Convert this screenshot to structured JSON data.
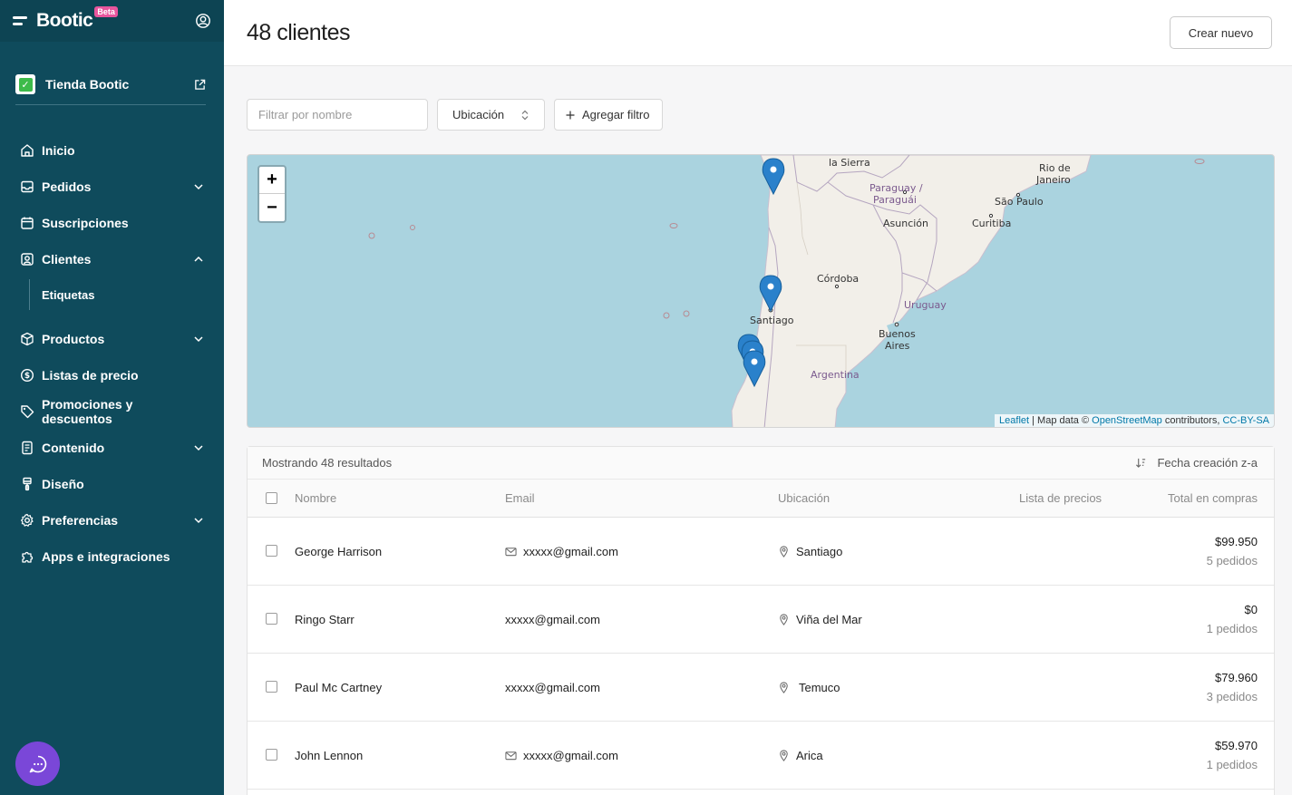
{
  "sidebar": {
    "logo": "Bootic",
    "beta": "Beta",
    "store_name": "Tienda Bootic",
    "items": [
      {
        "label": "Inicio"
      },
      {
        "label": "Pedidos"
      },
      {
        "label": "Suscripciones"
      },
      {
        "label": "Clientes"
      },
      {
        "label": "Etiquetas"
      },
      {
        "label": "Productos"
      },
      {
        "label": "Listas de precio"
      },
      {
        "label": "Promociones y descuentos"
      },
      {
        "label": "Contenido"
      },
      {
        "label": "Diseño"
      },
      {
        "label": "Preferencias"
      },
      {
        "label": "Apps e integraciones"
      }
    ]
  },
  "header": {
    "title": "48 clientes",
    "new_button": "Crear nuevo"
  },
  "filters": {
    "name_placeholder": "Filtrar por nombre",
    "location_select": "Ubicación",
    "add_filter": "Agregar filtro"
  },
  "map": {
    "zoom_in": "+",
    "zoom_out": "−",
    "labels": {
      "la_sierra": "la Sierra",
      "paraguay": "Paraguay /",
      "paraguai": "Paraguái",
      "asuncion": "Asunción",
      "rio": "Rio de",
      "janeiro": "Janeiro",
      "sao_paulo": "São Paulo",
      "curitiba": "Curitiba",
      "cordoba": "Córdoba",
      "uruguay": "Uruguay",
      "santiago": "Santiago",
      "buenos": "Buenos",
      "aires": "Aires",
      "argentina": "Argentina"
    },
    "attribution": {
      "leaflet": "Leaflet",
      "sep": " | Map data © ",
      "osm": "OpenStreetMap",
      "contrib": " contributors, ",
      "license": "CC-BY-SA"
    }
  },
  "table": {
    "results_text": "Mostrando 48 resultados",
    "sort_label": "Fecha creación z-a",
    "columns": {
      "name": "Nombre",
      "email": "Email",
      "location": "Ubicación",
      "price_list": "Lista de precios",
      "total": "Total en compras"
    },
    "rows": [
      {
        "name": "George Harrison",
        "email": "xxxxx@gmail.com",
        "location": "Santiago",
        "total": "$99.950",
        "orders": "5 pedidos"
      },
      {
        "name": "Ringo Starr",
        "email": "xxxxx@gmail.com",
        "location": "Viña del Mar",
        "total": "$0",
        "orders": "1 pedidos"
      },
      {
        "name": "Paul Mc Cartney",
        "email": "xxxxx@gmail.com",
        "location": "Temuco",
        "total": "$79.960",
        "orders": "3 pedidos"
      },
      {
        "name": "John Lennon",
        "email": "xxxxx@gmail.com",
        "location": "Arica",
        "total": "$59.970",
        "orders": "1 pedidos"
      }
    ]
  },
  "colors": {
    "sidebar": "#0f4b5c",
    "chat": "#7a47d8",
    "water": "#aad3df",
    "land": "#f2efe9",
    "marker": "#2a81cb"
  }
}
